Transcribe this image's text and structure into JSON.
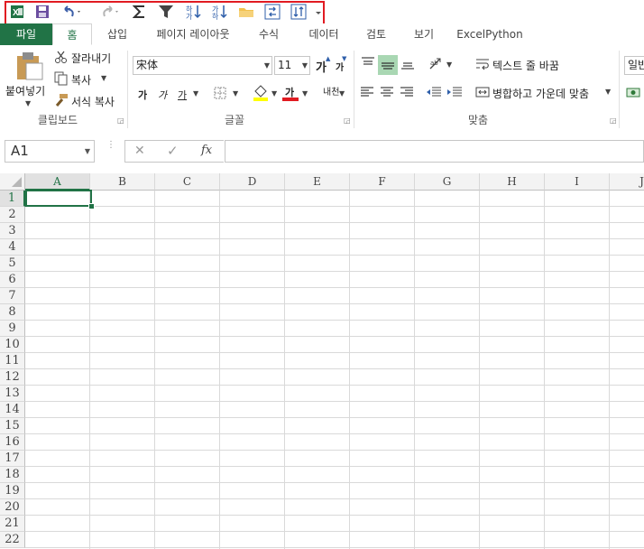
{
  "quick_access": {
    "app_icon": "excel-icon",
    "save": "save-icon",
    "undo": "undo-icon",
    "redo": "redo-icon",
    "autosum": "autosum-icon",
    "filter": "filter-icon",
    "sort_asc": "sort-ascending-icon",
    "sort_desc": "sort-descending-icon",
    "open": "folder-icon",
    "refresh": "refresh-icon",
    "swap": "swap-icon",
    "more": "chevron-down-icon",
    "highlight_color": "#e11b22"
  },
  "tabs": [
    "파일",
    "홈",
    "삽입",
    "페이지 레이아웃",
    "수식",
    "데이터",
    "검토",
    "보기",
    "ExcelPython"
  ],
  "clipboard": {
    "paste_label": "붙여넣기",
    "cut_label": "잘라내기",
    "copy_label": "복사",
    "format_painter_label": "서식 복사",
    "group_label": "클립보드"
  },
  "font": {
    "font_name": "宋体",
    "font_size": "11",
    "grow_label": "가",
    "shrink_label": "가",
    "bold_label": "가",
    "italic_label": "가",
    "underline_label": "가",
    "font_color_label": "가",
    "phonetic_label": "내천",
    "group_label": "글꼴"
  },
  "alignment": {
    "wrap_text_label": "텍스트 줄 바꿈",
    "merge_center_label": "병합하고 가운데 맞춤",
    "group_label": "맞춤"
  },
  "number": {
    "format_label": "일반"
  },
  "formula_bar": {
    "name_box": "A1",
    "cancel": "✕",
    "confirm": "✓",
    "fx": "fx",
    "formula": ""
  },
  "grid": {
    "columns": [
      "A",
      "B",
      "C",
      "D",
      "E",
      "F",
      "G",
      "H",
      "I",
      "J"
    ],
    "rows": [
      "1",
      "2",
      "3",
      "4",
      "5",
      "6",
      "7",
      "8",
      "9",
      "10",
      "11",
      "12",
      "13",
      "14",
      "15",
      "16",
      "17",
      "18",
      "19",
      "20",
      "21",
      "22"
    ],
    "selected_cell": "A1"
  },
  "colors": {
    "brand": "#217346",
    "active_align": "#a9d7b3"
  }
}
